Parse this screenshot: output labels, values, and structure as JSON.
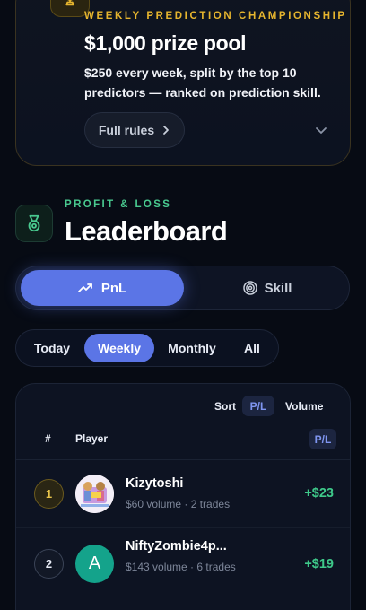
{
  "prize": {
    "eyebrow": "WEEKLY PREDICTION CHAMPIONSHIP",
    "title": "$1,000 prize pool",
    "description": "$250 every week, split by the top 10 predictors — ranked on prediction skill.",
    "rules_label": "Full rules",
    "icon": "trophy-icon"
  },
  "leaderboard": {
    "eyebrow": "PROFIT & LOSS",
    "title": "Leaderboard",
    "icon": "medal-icon"
  },
  "mode_toggle": {
    "pnl_label": "PnL",
    "skill_label": "Skill",
    "active": "PnL"
  },
  "period_tabs": {
    "items": [
      "Today",
      "Weekly",
      "Monthly",
      "All"
    ],
    "active": "Weekly"
  },
  "table": {
    "sort_label": "Sort",
    "sort_pl": "P/L",
    "sort_volume": "Volume",
    "col_rank": "#",
    "col_player": "Player",
    "col_pl": "P/L",
    "rows": [
      {
        "rank": "1",
        "name": "Kizytoshi",
        "meta": "$60 volume · 2 trades",
        "pl": "+$23",
        "avatar": "image"
      },
      {
        "rank": "2",
        "name": "NiftyZombie4p...",
        "meta": "$143 volume · 6 trades",
        "pl": "+$19",
        "avatar_letter": "A"
      }
    ]
  },
  "colors": {
    "accent": "#5b75e6",
    "gold": "#e6b52e",
    "green": "#3ec98a",
    "background": "#070b14"
  }
}
